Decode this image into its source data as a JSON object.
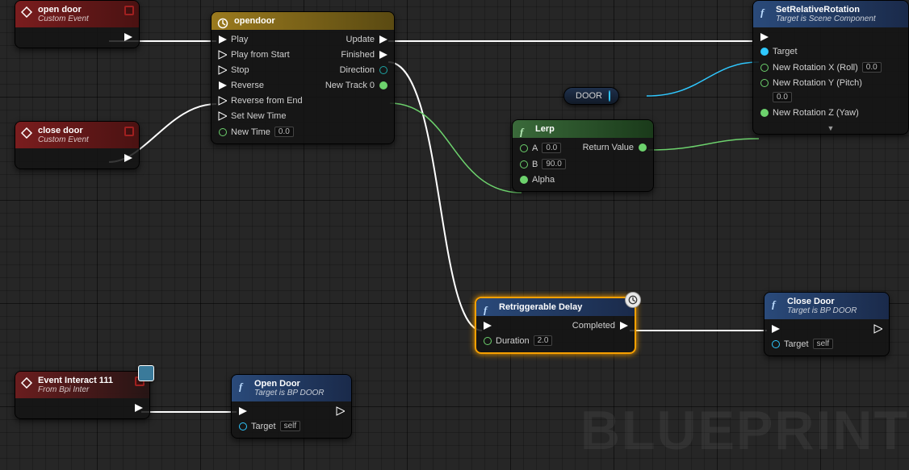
{
  "watermark": "BLUEPRINT",
  "nodes": {
    "open_door_event": {
      "title": "open door",
      "subtitle": "Custom Event"
    },
    "close_door_event": {
      "title": "close door",
      "subtitle": "Custom Event"
    },
    "timeline": {
      "title": "opendoor",
      "pins": {
        "play": "Play",
        "play_from_start": "Play from Start",
        "stop": "Stop",
        "reverse": "Reverse",
        "reverse_from_end": "Reverse from End",
        "set_new_time": "Set New Time",
        "new_time": "New Time",
        "new_time_val": "0.0",
        "update": "Update",
        "finished": "Finished",
        "direction": "Direction",
        "new_track": "New Track 0"
      }
    },
    "door_var": "DOOR",
    "lerp": {
      "title": "Lerp",
      "a": "A",
      "a_val": "0.0",
      "b": "B",
      "b_val": "90.0",
      "alpha": "Alpha",
      "return": "Return Value"
    },
    "set_rot": {
      "title": "SetRelativeRotation",
      "subtitle": "Target is Scene Component",
      "target": "Target",
      "rx": "New Rotation X (Roll)",
      "rx_val": "0.0",
      "ry": "New Rotation Y (Pitch)",
      "ry_val": "0.0",
      "rz": "New Rotation Z (Yaw)"
    },
    "delay": {
      "title": "Retriggerable Delay",
      "duration": "Duration",
      "duration_val": "2.0",
      "completed": "Completed"
    },
    "close_door_call": {
      "title": "Close Door",
      "subtitle": "Target is BP DOOR",
      "target": "Target",
      "target_val": "self"
    },
    "event_interact": {
      "title": "Event Interact 111",
      "subtitle": "From Bpi Inter"
    },
    "open_door_call": {
      "title": "Open Door",
      "subtitle": "Target is BP DOOR",
      "target": "Target",
      "target_val": "self"
    }
  }
}
